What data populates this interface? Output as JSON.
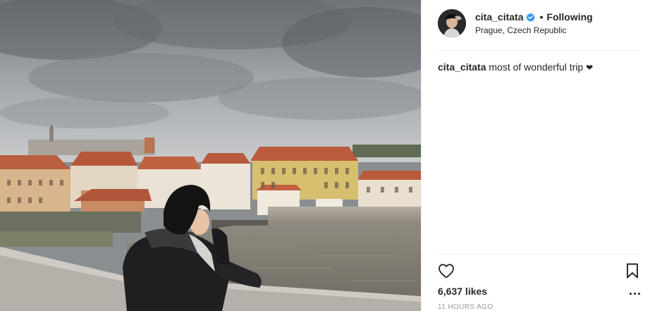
{
  "post": {
    "username": "cita_citata",
    "verified": true,
    "follow_label": "Following",
    "separator": "•",
    "location": "Prague, Czech Republic"
  },
  "caption": {
    "username": "cita_citata",
    "text": "most of wonderful trip",
    "emoji": "❤"
  },
  "engagement": {
    "likes": "6,637 likes",
    "timestamp": "11 HOURS AGO"
  },
  "icons": {
    "avatar": "avatar-photo",
    "verified": "verified-badge-icon",
    "like": "heart-icon",
    "save": "bookmark-icon",
    "more": "more-options-icon"
  },
  "colors": {
    "verified_blue": "#3897f0",
    "text": "#262626",
    "muted": "#999999",
    "divider": "#efefef"
  }
}
